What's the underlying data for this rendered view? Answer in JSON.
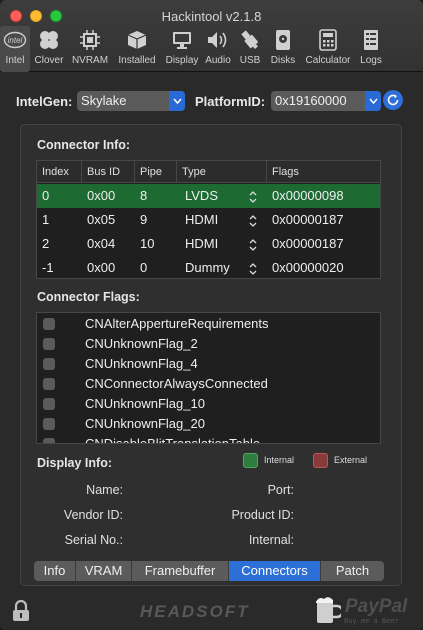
{
  "window": {
    "title": "Hackintool v2.1.8"
  },
  "toolbar": {
    "items": [
      {
        "label": "Intel",
        "icon": "intel-icon",
        "active": true
      },
      {
        "label": "Clover",
        "icon": "clover-icon"
      },
      {
        "label": "NVRAM",
        "icon": "chip-icon"
      },
      {
        "label": "Installed",
        "icon": "box-icon"
      },
      {
        "label": "Display",
        "icon": "monitor-icon"
      },
      {
        "label": "Audio",
        "icon": "speaker-icon"
      },
      {
        "label": "USB",
        "icon": "usb-icon"
      },
      {
        "label": "Disks",
        "icon": "disk-icon"
      },
      {
        "label": "Calculator",
        "icon": "calculator-icon"
      },
      {
        "label": "Logs",
        "icon": "logs-icon"
      }
    ]
  },
  "gen": {
    "intel_gen_label": "IntelGen:",
    "intel_gen_value": "Skylake",
    "platform_label": "PlatformID:",
    "platform_value": "0x19160000"
  },
  "connector_info": {
    "title": "Connector Info:",
    "columns": [
      "Index",
      "Bus ID",
      "Pipe",
      "Type",
      "Flags"
    ],
    "rows": [
      {
        "index": "0",
        "bus_id": "0x00",
        "pipe": "8",
        "type": "LVDS",
        "flags": "0x00000098",
        "selected": true
      },
      {
        "index": "1",
        "bus_id": "0x05",
        "pipe": "9",
        "type": "HDMI",
        "flags": "0x00000187"
      },
      {
        "index": "2",
        "bus_id": "0x04",
        "pipe": "10",
        "type": "HDMI",
        "flags": "0x00000187"
      },
      {
        "index": "-1",
        "bus_id": "0x00",
        "pipe": "0",
        "type": "Dummy",
        "flags": "0x00000020"
      }
    ]
  },
  "connector_flags": {
    "title": "Connector Flags:",
    "items": [
      "CNAlterAppertureRequirements",
      "CNUnknownFlag_2",
      "CNUnknownFlag_4",
      "CNConnectorAlwaysConnected",
      "CNUnknownFlag_10",
      "CNUnknownFlag_20",
      "CNDisableBlitTranslationTable"
    ]
  },
  "display_info": {
    "title": "Display Info:",
    "legend_internal": "Internal",
    "legend_external": "External",
    "name_label": "Name:",
    "port_label": "Port:",
    "vendor_label": "Vendor ID:",
    "product_label": "Product ID:",
    "serial_label": "Serial No.:",
    "internal_label": "Internal:"
  },
  "tabs": [
    "Info",
    "VRAM",
    "Framebuffer",
    "Connectors",
    "Patch"
  ],
  "active_tab": "Connectors",
  "footer": {
    "brand": "HEADSOFT",
    "paypal": "PayPal",
    "paypal_sub": "Buy me a Beer"
  },
  "colors": {
    "selected_row": "#1d6b33",
    "accent": "#2c6fd6",
    "internal": "#2f7d3e",
    "external": "#8b3a3a"
  }
}
